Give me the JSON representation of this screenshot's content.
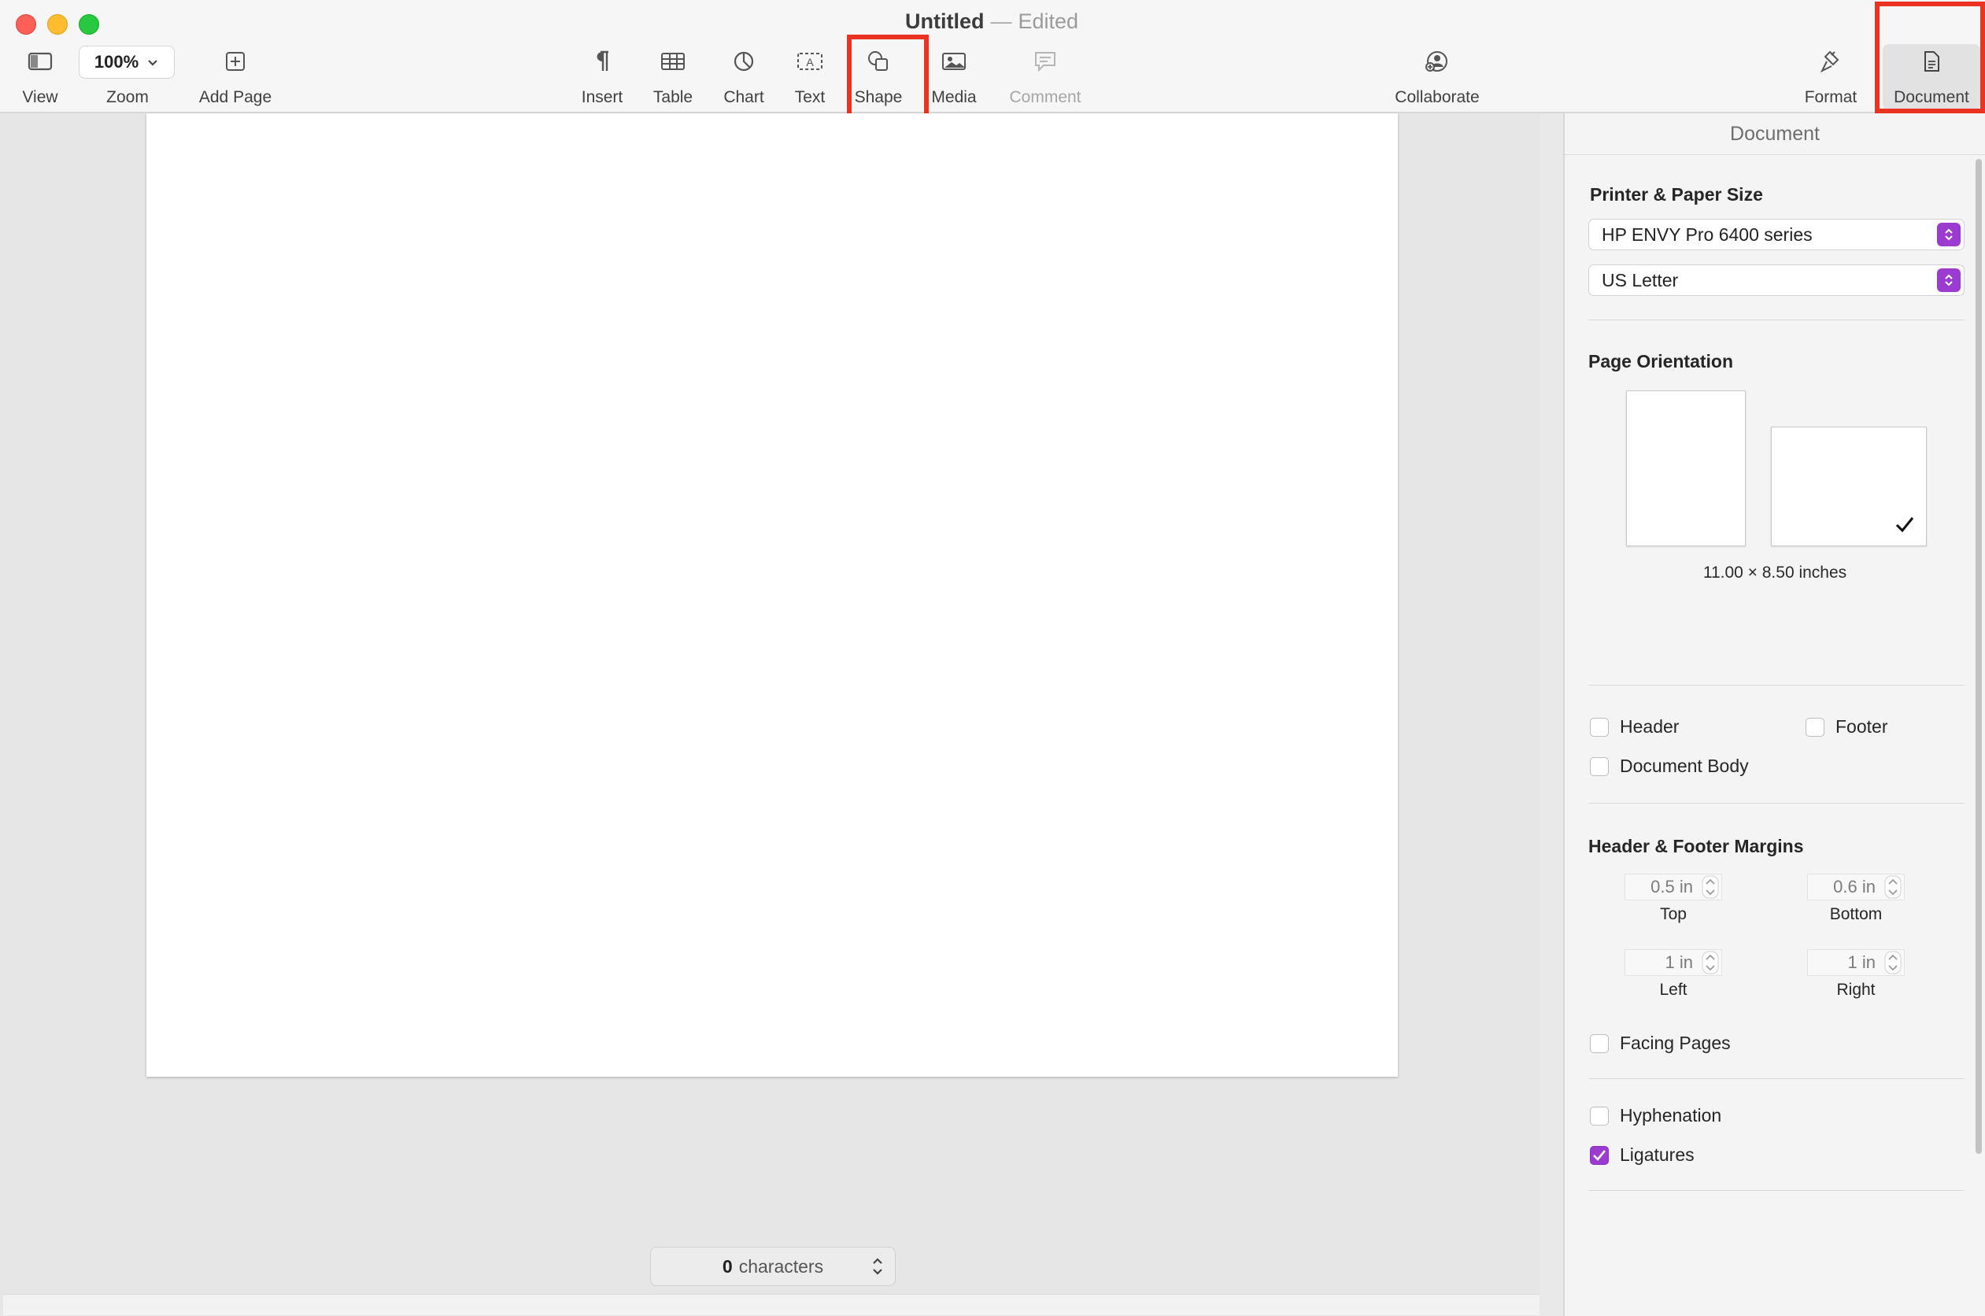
{
  "window": {
    "title": "Untitled",
    "title_separator": "—",
    "status": "Edited"
  },
  "toolbar": {
    "view": "View",
    "zoom_value": "100%",
    "zoom": "Zoom",
    "add_page": "Add Page",
    "insert": "Insert",
    "table": "Table",
    "chart": "Chart",
    "text": "Text",
    "shape": "Shape",
    "media": "Media",
    "comment": "Comment",
    "collaborate": "Collaborate",
    "format": "Format",
    "document": "Document"
  },
  "status_bar": {
    "char_count": "0",
    "char_label": "characters"
  },
  "sidebar": {
    "title": "Document",
    "printer_section": "Printer & Paper Size",
    "printer": "HP ENVY Pro 6400 series",
    "paper_size": "US Letter",
    "orientation_section": "Page Orientation",
    "orientation_selected": "landscape",
    "page_dimensions": "11.00 × 8.50 inches",
    "header_label": "Header",
    "header_checked": false,
    "footer_label": "Footer",
    "footer_checked": false,
    "document_body_label": "Document Body",
    "document_body_checked": false,
    "margins_section": "Header & Footer Margins",
    "margin_top_value": "0.5 in",
    "margin_top_label": "Top",
    "margin_bottom_value": "0.6 in",
    "margin_bottom_label": "Bottom",
    "margin_left_value": "1 in",
    "margin_left_label": "Left",
    "margin_right_value": "1 in",
    "margin_right_label": "Right",
    "facing_pages_label": "Facing Pages",
    "facing_pages_checked": false,
    "hyphenation_label": "Hyphenation",
    "hyphenation_checked": false,
    "ligatures_label": "Ligatures",
    "ligatures_checked": true
  },
  "colors": {
    "accent": "#9b3bd0",
    "highlight": "#ea3323"
  }
}
